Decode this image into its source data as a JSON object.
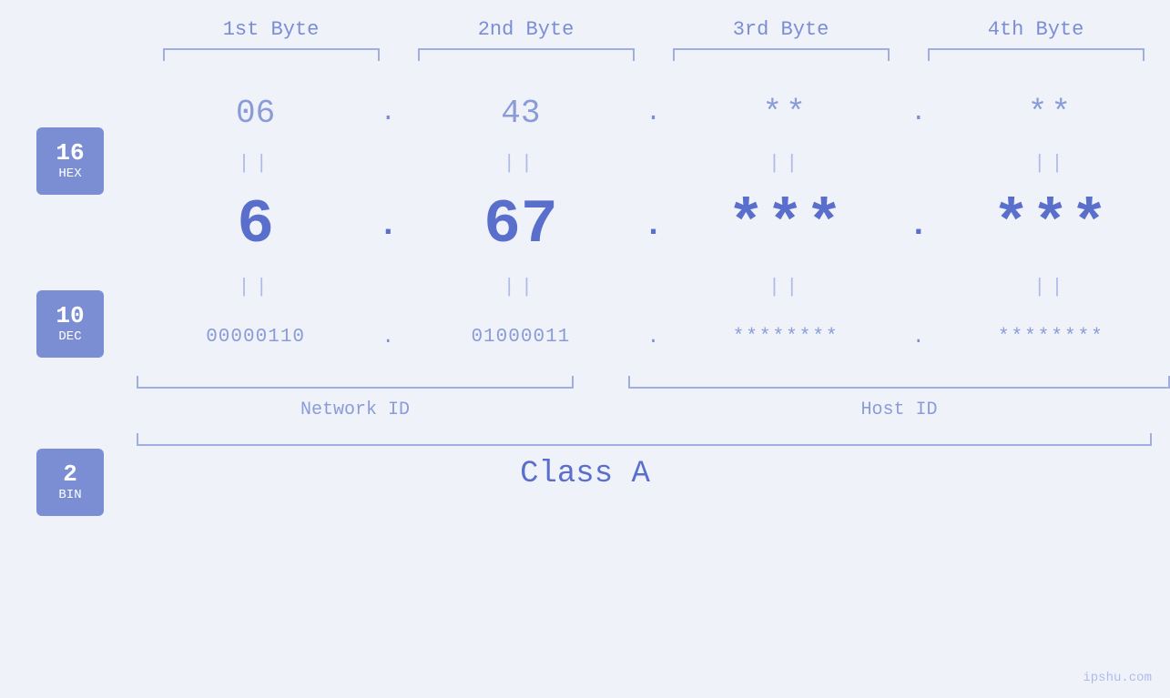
{
  "headers": {
    "byte1": "1st Byte",
    "byte2": "2nd Byte",
    "byte3": "3rd Byte",
    "byte4": "4th Byte"
  },
  "badges": {
    "hex": {
      "num": "16",
      "label": "HEX"
    },
    "dec": {
      "num": "10",
      "label": "DEC"
    },
    "bin": {
      "num": "2",
      "label": "BIN"
    }
  },
  "hex_row": {
    "b1": "06",
    "b2": "43",
    "b3": "**",
    "b4": "**"
  },
  "dec_row": {
    "b1": "6",
    "b2": "67",
    "b3": "***",
    "b4": "***"
  },
  "bin_row": {
    "b1": "00000110",
    "b2": "01000011",
    "b3": "********",
    "b4": "********"
  },
  "labels": {
    "network_id": "Network ID",
    "host_id": "Host ID",
    "class": "Class A"
  },
  "watermark": "ipshu.com",
  "equals": "||"
}
